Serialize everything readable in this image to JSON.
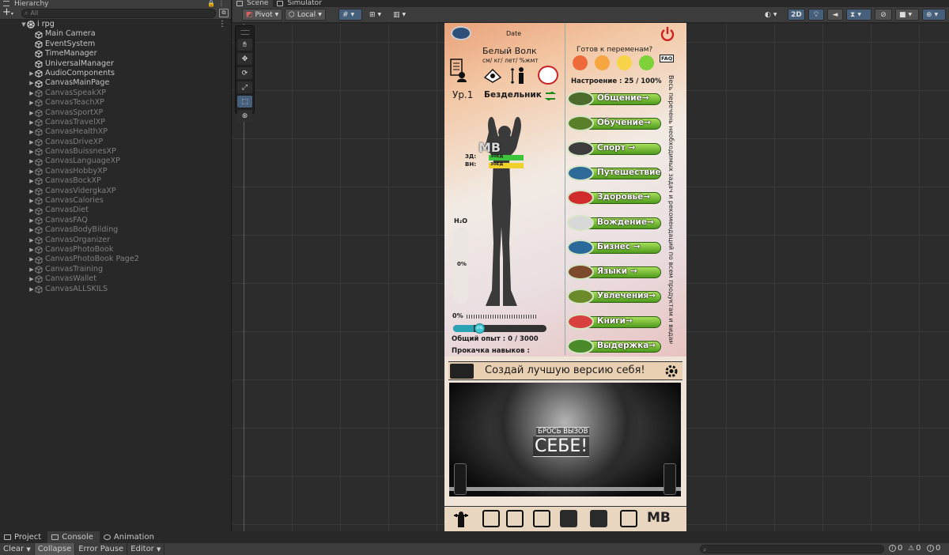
{
  "hierarchy": {
    "tab_label": "Hierarchy",
    "add_label": "+",
    "search_placeholder": "All",
    "scene_name": "i rpg",
    "items": [
      {
        "label": "Main Camera",
        "active": true,
        "expandable": false
      },
      {
        "label": "EventSystem",
        "active": true,
        "expandable": false
      },
      {
        "label": "TimeManager",
        "active": true,
        "expandable": false
      },
      {
        "label": "UniversalManager",
        "active": true,
        "expandable": false
      },
      {
        "label": "AudioComponents",
        "active": true,
        "expandable": true
      },
      {
        "label": "CanvasMainPage",
        "active": true,
        "expandable": true
      },
      {
        "label": "CanvasSpeakXP",
        "active": false,
        "expandable": true
      },
      {
        "label": "CanvasTeachXP",
        "active": false,
        "expandable": true
      },
      {
        "label": "CanvasSportXP",
        "active": false,
        "expandable": true
      },
      {
        "label": "CanvasTravelXP",
        "active": false,
        "expandable": true
      },
      {
        "label": "CanvasHealthXP",
        "active": false,
        "expandable": true
      },
      {
        "label": "CanvasDriveXP",
        "active": false,
        "expandable": true
      },
      {
        "label": "CanvasBuissnesXP",
        "active": false,
        "expandable": true
      },
      {
        "label": "CanvasLanguageXP",
        "active": false,
        "expandable": true
      },
      {
        "label": "CanvasHobbyXP",
        "active": false,
        "expandable": true
      },
      {
        "label": "CanvasBockXP",
        "active": false,
        "expandable": true
      },
      {
        "label": "CanvasVidergkaXP",
        "active": false,
        "expandable": true
      },
      {
        "label": "CanvasCalories",
        "active": false,
        "expandable": true
      },
      {
        "label": "CanvasDiet",
        "active": false,
        "expandable": true
      },
      {
        "label": "CanvasFAQ",
        "active": false,
        "expandable": true
      },
      {
        "label": "CanvasBodyBilding",
        "active": false,
        "expandable": true
      },
      {
        "label": "CanvasOrganizer",
        "active": false,
        "expandable": true
      },
      {
        "label": "CanvasPhotoBook",
        "active": false,
        "expandable": true
      },
      {
        "label": "CanvasPhotoBook Page2",
        "active": false,
        "expandable": true
      },
      {
        "label": "CanvasTraining",
        "active": false,
        "expandable": true
      },
      {
        "label": "CanvasWallet",
        "active": false,
        "expandable": true
      },
      {
        "label": "CanvasALLSKILS",
        "active": false,
        "expandable": true
      }
    ]
  },
  "scene": {
    "tabs": [
      "Scene",
      "Simulator"
    ],
    "toolbar": {
      "pivot_label": "Pivot",
      "local_label": "Local",
      "mode_2d_label": "2D"
    }
  },
  "game": {
    "date_label": "Date",
    "user_name": "Белый Волк",
    "units_row": "см/   кг/   лет/   %жмт",
    "ready_label": "Готов к переменам?",
    "faq_label": "FAQ",
    "mood_label": "Настроение : 25 / 100%",
    "level_label": "Ур.1",
    "status_label": "Бездельник",
    "mb_label": "MB",
    "stat1_label": "ЗД:",
    "stat1_value": "30ЕД",
    "stat2_label": "ВН:",
    "stat2_value": "30ЕД",
    "water_label": "H₂O",
    "water_percent": "0%",
    "water_fill": 0,
    "progress_percent": "0%",
    "progress_inner": "0%",
    "xp_fill": 0.22,
    "total_xp_label": "Общий опыт : 0 / 3000",
    "skills_label": "Прокачка навыков :",
    "side_text": "Весь перечень необходимых задач и рекомендаций по всем продуктам и видам",
    "skill_buttons": [
      {
        "label": "Общение→",
        "color": "#4c6b2c"
      },
      {
        "label": "Обучение→",
        "color": "#5a7f2a"
      },
      {
        "label": "Спорт →",
        "color": "#3c3c3c"
      },
      {
        "label": "Путешествие",
        "color": "#2d6a98"
      },
      {
        "label": "Здоровье→",
        "color": "#d02c2c"
      },
      {
        "label": "Вождение→",
        "color": "#d8d8d8"
      },
      {
        "label": "Бизнес →",
        "color": "#2a6a9a"
      },
      {
        "label": "Языки →",
        "color": "#7b4a2a"
      },
      {
        "label": "Увлечения→",
        "color": "#6b8a2a"
      },
      {
        "label": "Книги→",
        "color": "#d84040"
      },
      {
        "label": "Выдержка→",
        "color": "#4a8a2a"
      }
    ],
    "banner_text": "Создай лучшую версию себя!",
    "photo_caption_small": "БРОСЬ ВЫЗОВ",
    "photo_caption_big": "СЕБЕ!",
    "bottom_mb_label": "MB"
  },
  "dock": {
    "tabs": [
      "Project",
      "Console",
      "Animation"
    ],
    "console_buttons": [
      "Clear",
      "Collapse",
      "Error Pause",
      "Editor"
    ],
    "counts": {
      "info": "0",
      "warn": "0",
      "error": "0"
    }
  },
  "colors": {
    "accent_blue": "#46607c",
    "button_green": "#6fbf2d"
  }
}
